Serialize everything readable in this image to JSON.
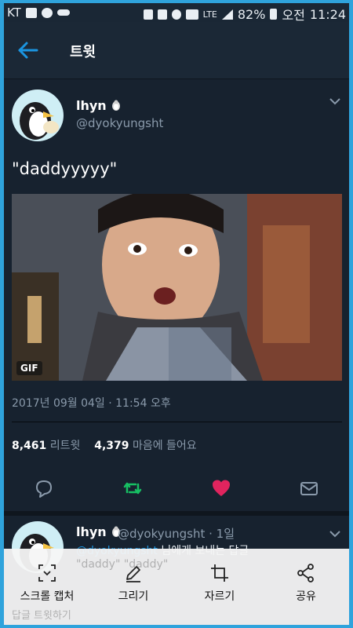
{
  "statusbar": {
    "carrier": "KT",
    "battery": "82%",
    "network": "LTE",
    "ampm": "오전",
    "time": "11:24"
  },
  "header": {
    "title": "트윗"
  },
  "tweet": {
    "name": "lhyn",
    "handle": "@dyokyungsht",
    "text": "\"daddyyyyy\"",
    "gif_label": "GIF",
    "date": "2017년 09월 04일 · 11:54 오후",
    "retweets_count": "8,461",
    "retweets_label": "리트윗",
    "likes_count": "4,379",
    "likes_label": "마음에 들어요"
  },
  "reply": {
    "name": "lhyn",
    "meta": "@dyokyungsht · 1일",
    "mention": "@dyokyungsht",
    "mention_suffix": " 님에게 보내는 답글",
    "text": "\"daddy\" \"daddy\""
  },
  "toolbar": {
    "scroll_capture": "스크롤 캡처",
    "draw": "그리기",
    "crop": "자르기",
    "share": "공유",
    "hidden_hint": "답글 트윗하기"
  },
  "colors": {
    "background": "#17222f",
    "accent": "#1b95e0",
    "retweet": "#17bf63",
    "like": "#e0245e",
    "frame": "#2fa3dc"
  }
}
